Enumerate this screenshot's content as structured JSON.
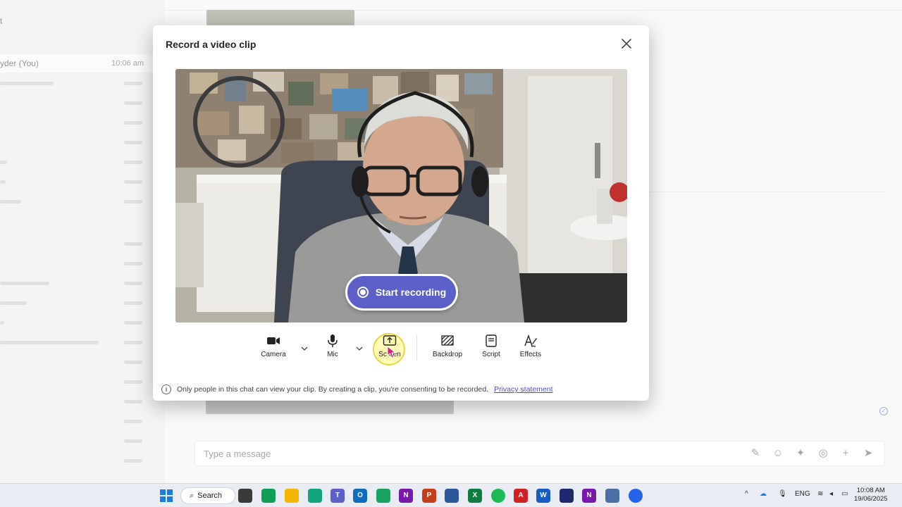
{
  "background": {
    "chat_list": [
      {
        "name": "t",
        "time": ""
      },
      {
        "name": "yder (You)",
        "time": "10:06 am",
        "selected": true
      },
      {
        "name": "",
        "time": ""
      },
      {
        "name": "",
        "time": ""
      },
      {
        "name": "",
        "time": ""
      }
    ],
    "composer_placeholder": "Type a message"
  },
  "modal": {
    "title": "Record a video clip",
    "record_label": "Start recording",
    "toolbar": {
      "camera": "Camera",
      "mic": "Mic",
      "screen": "Screen",
      "backdrop": "Backdrop",
      "script": "Script",
      "effects": "Effects"
    },
    "notice_text": "Only people in this chat can view your clip. By creating a clip, you're consenting to be recorded.",
    "privacy_link": "Privacy statement",
    "accent_color": "#5b5fc7"
  },
  "taskbar": {
    "search_label": "Search",
    "language": "ENG",
    "time": "10:08 AM",
    "date": "19/06/2025"
  }
}
